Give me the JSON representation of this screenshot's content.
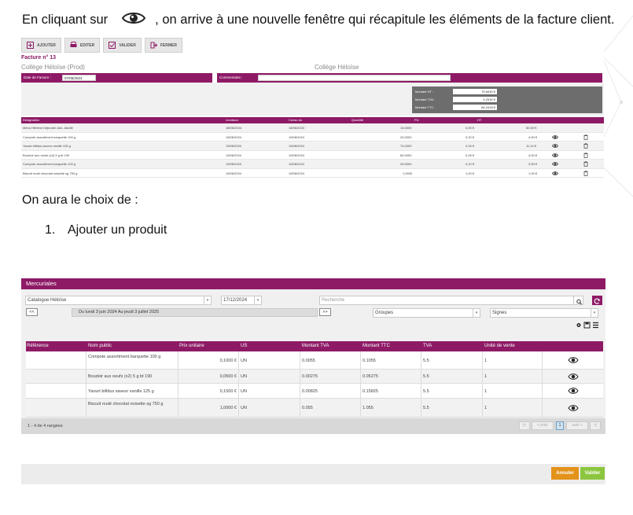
{
  "intro": {
    "before": "En cliquant sur",
    "after": ", on arrive à une nouvelle fenêtre qui récapitule les éléments de la facture client."
  },
  "invoice": {
    "toolbar": [
      "AJOUTER",
      "EDITER",
      "VALIDER",
      "FERMER"
    ],
    "title": "Facture n° 13",
    "school": "Collège Héloïse (Prod)",
    "school_center": "Collège Héloïse",
    "date_label": "Date de Facture :",
    "date_value": "07/06/2024",
    "comment_label": "Commentaire :",
    "totals": [
      {
        "label": "Montant HT :",
        "value": "75,6530 €"
      },
      {
        "label": "Montant TVA :",
        "value": "4,2916 €"
      },
      {
        "label": "Montant TTC :",
        "value": "84,2416 €"
      }
    ],
    "headers": [
      "Désignation",
      "Livraison",
      "Conso du",
      "Quantité",
      "PU",
      "HT"
    ],
    "rows": [
      [
        "Menu Hébène Déjeuner Ado. Adulte",
        "18/06/2024",
        "18/06/2024",
        "10,0000",
        "0,00 €",
        "50,00 €"
      ],
      [
        "Compote assortiment barquette 100 g",
        "19/06/2024",
        "19/06/2024",
        "20,0000",
        "0,20 €",
        "4,00 €"
      ],
      [
        "Yaourt bifidus saveur vanille 125 g",
        "19/06/2024",
        "19/06/2024",
        "74,0000",
        "0,15 €",
        "11,10 €"
      ],
      [
        "Boudoir aux oeufs (x2) 5 g bt 190",
        "19/06/2024",
        "19/06/2024",
        "80,0000",
        "0,05 €",
        "4,00 €"
      ],
      [
        "Compote assortiment barquette 100 g",
        "19/06/2024",
        "19/06/2024",
        "39,0000",
        "0,10 €",
        "3,90 €"
      ],
      [
        "Biscuit roulé chocolat noisette sg 750 g",
        "19/06/2024",
        "19/06/2024",
        "1,0000",
        "1,00 €",
        "1,00 €"
      ]
    ]
  },
  "para1": "On aura le choix de :",
  "list_item": {
    "num": "1.",
    "text": "Ajouter un produit"
  },
  "mercuriales": {
    "title": "Mercuriales",
    "catalogue": "Catalogue Héloïse",
    "date": "17/12/2024",
    "search_placeholder": "Recherche",
    "prev_btn": "<<",
    "next_btn": ">>",
    "period": "Du lundi 3 juin 2024 Au jeudi 3 juillet 2025",
    "groupes": "Groupes",
    "signes": "Signes",
    "headers": [
      "Référence",
      "Nom public",
      "Prix unitaire",
      "US",
      "Montant TVA",
      "Montant TTC",
      "TVA",
      "Unité de vente"
    ],
    "rows": [
      {
        "ref": "",
        "nom": "Compote assortiment barquette 100 g",
        "prix": "0,1000 €",
        "us": "UN",
        "mtva": "0.0055",
        "mttc": "0.1055",
        "tva": "5.5",
        "unite": "1"
      },
      {
        "ref": "",
        "nom": "Boudoir aux oeufs (x2) 5 g bt 190",
        "prix": "0,0500 €",
        "us": "UN",
        "mtva": "0.00275",
        "mttc": "0.05275",
        "tva": "5.5",
        "unite": "1"
      },
      {
        "ref": "",
        "nom": "Yaourt bifidus saveur vanille 125 g",
        "prix": "0,1500 €",
        "us": "UN",
        "mtva": "0.00825",
        "mttc": "0.15825",
        "tva": "5.5",
        "unite": "1"
      },
      {
        "ref": "",
        "nom": "Biscuit roulé chocolat noisette sg 750 g",
        "prix": "1,0000 €",
        "us": "UN",
        "mtva": "0.055",
        "mttc": "1.055",
        "tva": "5.5",
        "unite": "1"
      }
    ],
    "count": "1 - 4 de 4 rangées",
    "pager": [
      "|<",
      "< préc",
      "1",
      "suiv >",
      ">|"
    ],
    "cancel": "Annuler",
    "validate": "Valider"
  }
}
